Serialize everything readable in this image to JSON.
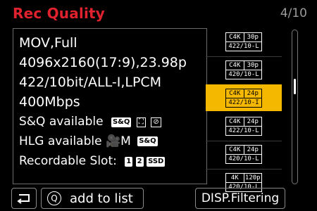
{
  "header": {
    "title": "Rec Quality",
    "page": "4/10"
  },
  "info": {
    "format": "MOV,Full",
    "resolution": "4096x2160(17:9),23.98p",
    "codec": "422/10bit/ALL-I,LPCM",
    "bitrate": "400Mbps",
    "sq_label": "S&Q available",
    "sq_chip": "S&Q",
    "hlg_label": "HLG available",
    "hlg_mode": "M",
    "hlg_chip": "S&Q",
    "slot_label": "Recordable Slot:",
    "slot1": "1",
    "slot2": "2",
    "slot3": "SSD"
  },
  "options": [
    {
      "res": "C4K",
      "fps": "30p",
      "codec": "422/10-L",
      "selected": false
    },
    {
      "res": "C4K",
      "fps": "30p",
      "codec": "420/10-L",
      "selected": false
    },
    {
      "res": "C4K",
      "fps": "24p",
      "codec": "422/10-I",
      "selected": true
    },
    {
      "res": "C4K",
      "fps": "24p",
      "codec": "422/10-L",
      "selected": false
    },
    {
      "res": "C4K",
      "fps": "24p",
      "codec": "420/10-L",
      "selected": false
    },
    {
      "res": "4K",
      "fps": "120p",
      "codec": "420/10-L",
      "selected": false
    }
  ],
  "scroll": {
    "position": 0.35
  },
  "footer": {
    "back_icon": "return-arrow",
    "q_icon": "Q",
    "add_label": "add to list",
    "filter_label": "DISP.Filtering"
  },
  "colors": {
    "title": "#e0212e",
    "selected": "#f5b800"
  }
}
